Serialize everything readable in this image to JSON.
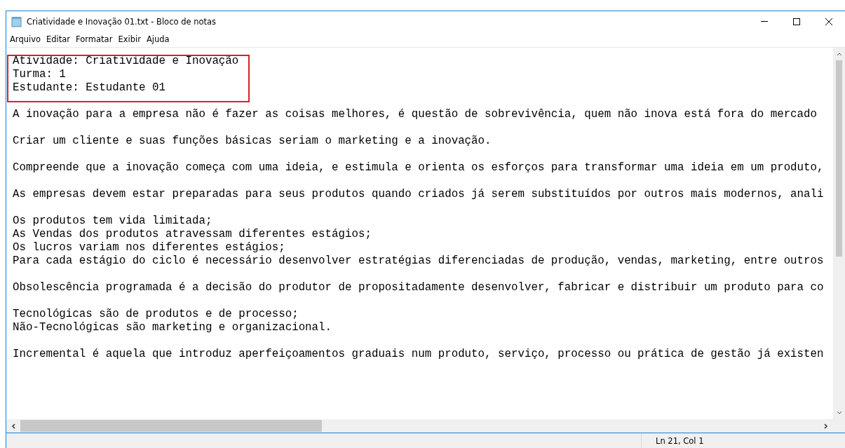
{
  "window": {
    "title": "Criatividade e Inovação 01.txt - Bloco de notas"
  },
  "menu": [
    "Arquivo",
    "Editar",
    "Formatar",
    "Exibir",
    "Ajuda"
  ],
  "editor": {
    "paragraphs": [
      [
        "Atividade: Criatividade e Inovação",
        "Turma: 1",
        "Estudante: Estudante 01"
      ],
      [
        "A inovação para a empresa não é fazer as coisas melhores, é questão de sobrevivência, quem não inova está fora do mercado"
      ],
      [
        "Criar um cliente e suas funções básicas seriam o marketing e a inovação."
      ],
      [
        "Compreende que a inovação começa com uma ideia, e estimula e orienta os esforços para transformar uma ideia em um produto,"
      ],
      [
        "As empresas devem estar preparadas para seus produtos quando criados já serem substituídos por outros mais modernos, anali"
      ],
      [
        "Os produtos tem vida limitada;",
        "As Vendas dos produtos atravessam diferentes estágios;",
        "Os lucros variam nos diferentes estágios;",
        "Para cada estágio do ciclo é necessário desenvolver estratégias diferenciadas de produção, vendas, marketing, entre outros"
      ],
      [
        "Obsolescência programada é a decisão do produtor de propositadamente desenvolver, fabricar e distribuir um produto para co"
      ],
      [
        "Tecnológicas são de produtos e de processo;",
        "Não-Tecnológicas são marketing e organizacional."
      ],
      [
        "Incremental é aquela que introduz aperfeiçoamentos graduais num produto, serviço, processo ou prática de gestão já existen"
      ]
    ],
    "highlight": {
      "on": true
    }
  },
  "status_bar": {
    "position": "Ln 21, Col 1"
  }
}
